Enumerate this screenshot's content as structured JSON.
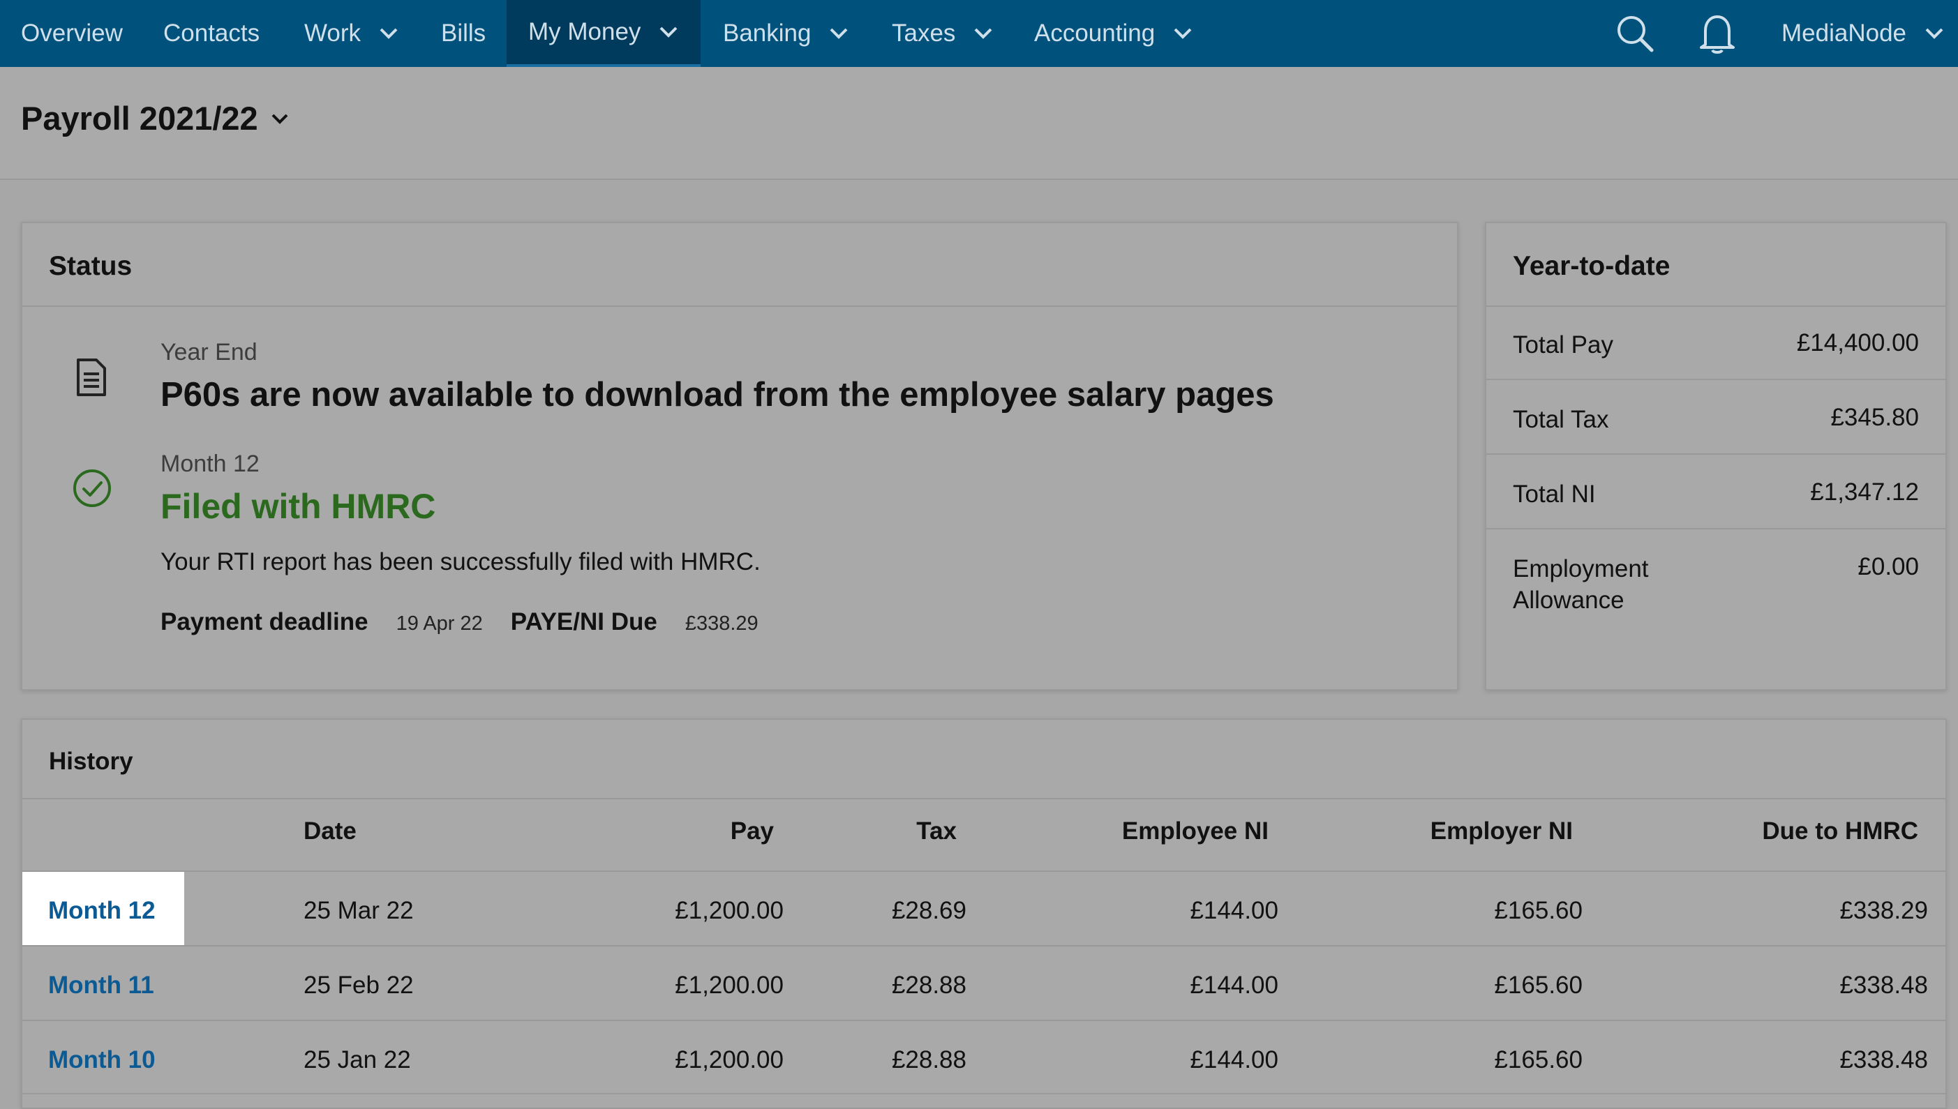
{
  "nav": {
    "items": [
      {
        "label": "Overview"
      },
      {
        "label": "Contacts"
      },
      {
        "label": "Work"
      },
      {
        "label": "Bills"
      },
      {
        "label": "My Money"
      },
      {
        "label": "Banking"
      },
      {
        "label": "Taxes"
      },
      {
        "label": "Accounting"
      }
    ],
    "active": "My Money",
    "account": "MediaNode"
  },
  "page": {
    "title": "Payroll 2021/22"
  },
  "status": {
    "title": "Status",
    "year_end": {
      "label": "Year End",
      "headline": "P60s are now available to download from the employee salary pages"
    },
    "month": {
      "label": "Month 12",
      "headline": "Filed with HMRC",
      "description": "Your RTI report has been successfully filed with HMRC.",
      "deadline_label": "Payment deadline",
      "deadline_value": "19 Apr 22",
      "due_label": "PAYE/NI Due",
      "due_value": "£338.29"
    }
  },
  "ytd": {
    "title": "Year-to-date",
    "rows": [
      {
        "label": "Total Pay",
        "value": "£14,400.00"
      },
      {
        "label": "Total Tax",
        "value": "£345.80"
      },
      {
        "label": "Total NI",
        "value": "£1,347.12"
      },
      {
        "label": "Employment Allowance",
        "value": "£0.00"
      }
    ]
  },
  "history": {
    "title": "History",
    "columns": [
      "Date",
      "Pay",
      "Tax",
      "Employee NI",
      "Employer NI",
      "Due to HMRC"
    ],
    "rows": [
      {
        "period": "Month 12",
        "date": "25 Mar 22",
        "pay": "£1,200.00",
        "tax": "£28.69",
        "employee_ni": "£144.00",
        "employer_ni": "£165.60",
        "due": "£338.29"
      },
      {
        "period": "Month 11",
        "date": "25 Feb 22",
        "pay": "£1,200.00",
        "tax": "£28.88",
        "employee_ni": "£144.00",
        "employer_ni": "£165.60",
        "due": "£338.48"
      },
      {
        "period": "Month 10",
        "date": "25 Jan 22",
        "pay": "£1,200.00",
        "tax": "£28.88",
        "employee_ni": "£144.00",
        "employer_ni": "£165.60",
        "due": "£338.48"
      }
    ]
  },
  "colors": {
    "nav_bg": "#00527d",
    "nav_active": "#003b5e",
    "link": "#0b5a93",
    "success": "#2b6a1e"
  }
}
